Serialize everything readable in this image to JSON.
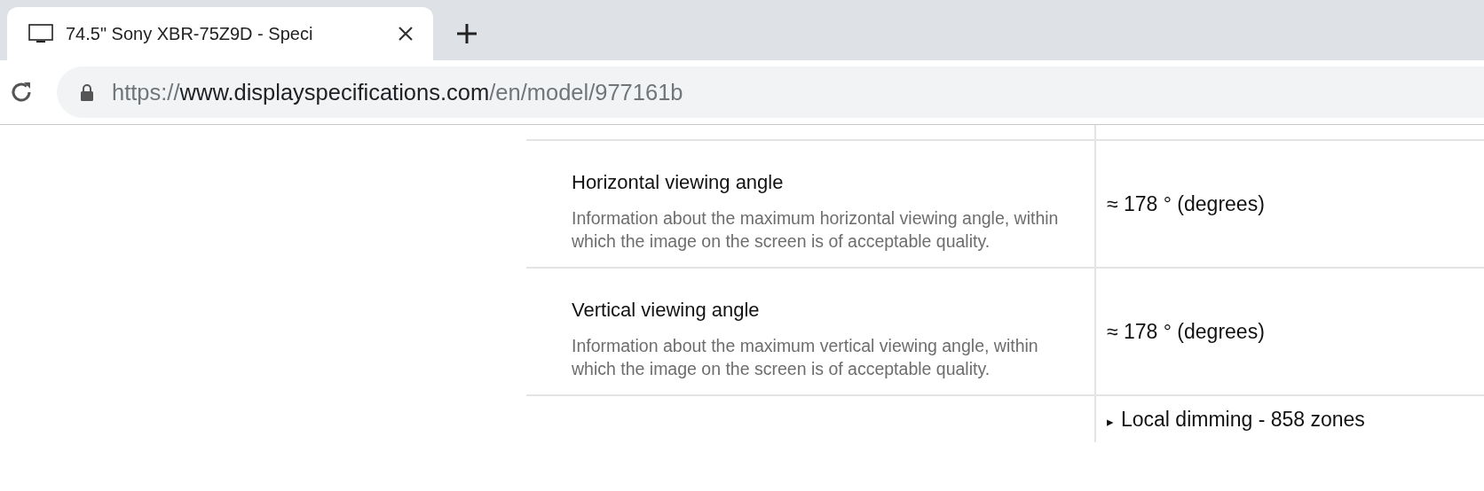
{
  "tabs": [
    {
      "title": "74.5\" Sony XBR-75Z9D - Speci",
      "selected": true
    }
  ],
  "address_bar": {
    "scheme": "https://",
    "host": "www.displayspecifications.com",
    "path": "/en/model/977161b"
  },
  "specs": [
    {
      "name": "Horizontal viewing angle",
      "description": "Information about the maximum horizontal viewing angle, within which the image on the screen is of acceptable quality.",
      "value": "≈ 178 ° (degrees)"
    },
    {
      "name": "Vertical viewing angle",
      "description": "Information about the maximum vertical viewing angle, within which the image on the screen is of acceptable quality.",
      "value": "≈ 178 ° (degrees)"
    }
  ],
  "disclosure": {
    "marker": "▸",
    "label": "Local dimming - 858 zones",
    "expanded": false
  }
}
